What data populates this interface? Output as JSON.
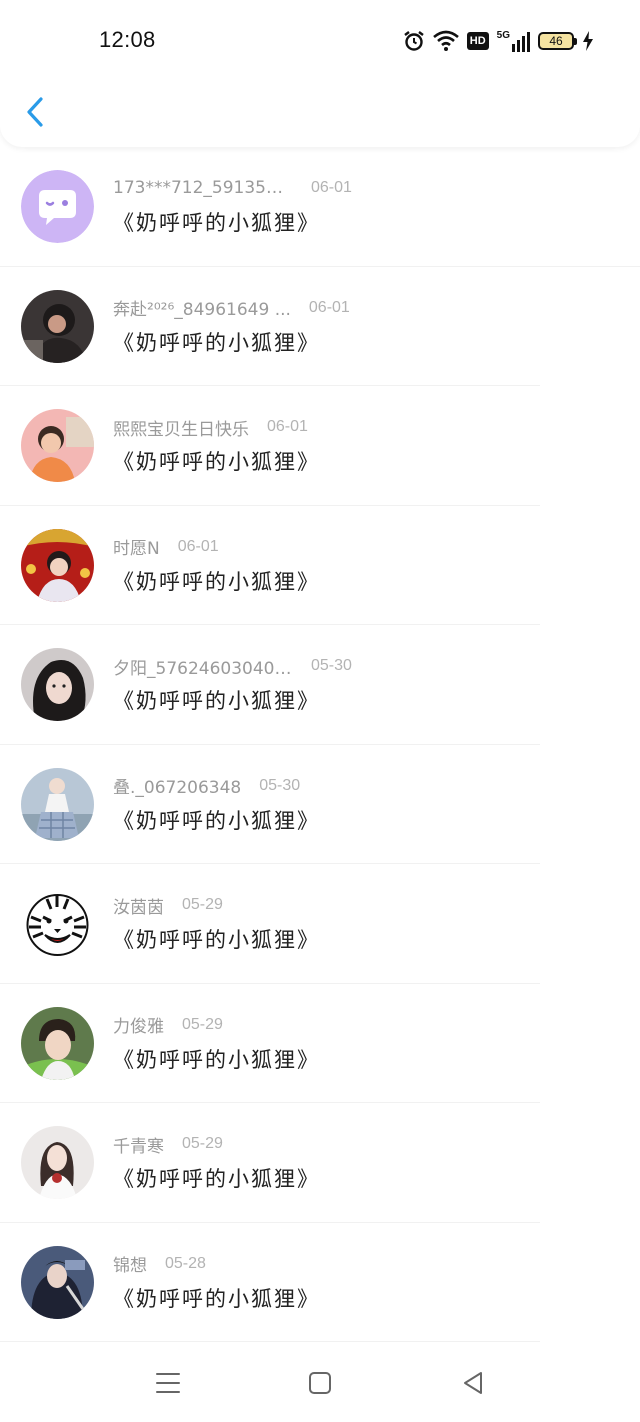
{
  "status_bar": {
    "time": "12:08",
    "battery": "46",
    "network_label": "5G",
    "hd_label": "HD"
  },
  "header": {
    "back_icon": "chevron-left-icon",
    "accent_color": "#2a9be8"
  },
  "messages": [
    {
      "name": "173***712_591359 ...",
      "date": "06-01",
      "text": "《奶呼呼的小狐狸》",
      "avatar": "chat-bubble-avatar"
    },
    {
      "name": "奔赴²⁰²⁶_84961649 ...",
      "date": "06-01",
      "text": "《奶呼呼的小狐狸》",
      "avatar": "user-photo"
    },
    {
      "name": "熙熙宝贝生日快乐",
      "date": "06-01",
      "text": "《奶呼呼的小狐狸》",
      "avatar": "user-photo"
    },
    {
      "name": "时愿N",
      "date": "06-01",
      "text": "《奶呼呼的小狐狸》",
      "avatar": "user-photo"
    },
    {
      "name": "夕阳_57624603040 ...",
      "date": "05-30",
      "text": "《奶呼呼的小狐狸》",
      "avatar": "user-photo"
    },
    {
      "name": "叠._067206348",
      "date": "05-30",
      "text": "《奶呼呼的小狐狸》",
      "avatar": "user-photo"
    },
    {
      "name": "汝茵茵",
      "date": "05-29",
      "text": "《奶呼呼的小狐狸》",
      "avatar": "tiger-photo"
    },
    {
      "name": "力俊雅",
      "date": "05-29",
      "text": "《奶呼呼的小狐狸》",
      "avatar": "user-photo"
    },
    {
      "name": "千青寒",
      "date": "05-29",
      "text": "《奶呼呼的小狐狸》",
      "avatar": "user-photo"
    },
    {
      "name": "锦想",
      "date": "05-28",
      "text": "《奶呼呼的小狐狸》",
      "avatar": "user-photo"
    }
  ],
  "nav_bar": {
    "menu_icon": "menu-icon",
    "home_icon": "home-square-icon",
    "back_icon": "back-triangle-icon"
  }
}
